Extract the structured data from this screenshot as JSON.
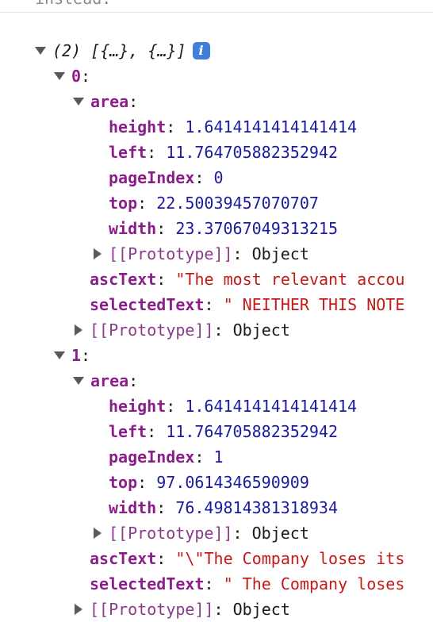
{
  "header_fragment": "instead.",
  "summary": "(2) [{…}, {…}]",
  "info_icon": "i",
  "items": [
    {
      "index": "0",
      "area_key": "area",
      "area": {
        "height": "1.6414141414141414",
        "left": "11.764705882352942",
        "pageIndex": "0",
        "top": "22.50039457070707",
        "width": "23.37067049313215"
      },
      "area_proto_key": "[[Prototype]]",
      "area_proto_val": "Object",
      "ascText_key": "ascText",
      "ascText": "\"The most relevant accou",
      "selectedText_key": "selectedText",
      "selectedText": "\" NEITHER THIS NOTE",
      "proto_key": "[[Prototype]]",
      "proto_val": "Object"
    },
    {
      "index": "1",
      "area_key": "area",
      "area": {
        "height": "1.6414141414141414",
        "left": "11.764705882352942",
        "pageIndex": "1",
        "top": "97.0614346590909",
        "width": "76.49814381318934"
      },
      "area_proto_key": "[[Prototype]]",
      "area_proto_val": "Object",
      "ascText_key": "ascText",
      "ascText": "\"\\\"The Company loses its",
      "selectedText_key": "selectedText",
      "selectedText": "\" The Company loses",
      "proto_key": "[[Prototype]]",
      "proto_val": "Object"
    }
  ],
  "labels": {
    "height": "height",
    "left": "left",
    "pageIndex": "pageIndex",
    "top": "top",
    "width": "width"
  }
}
